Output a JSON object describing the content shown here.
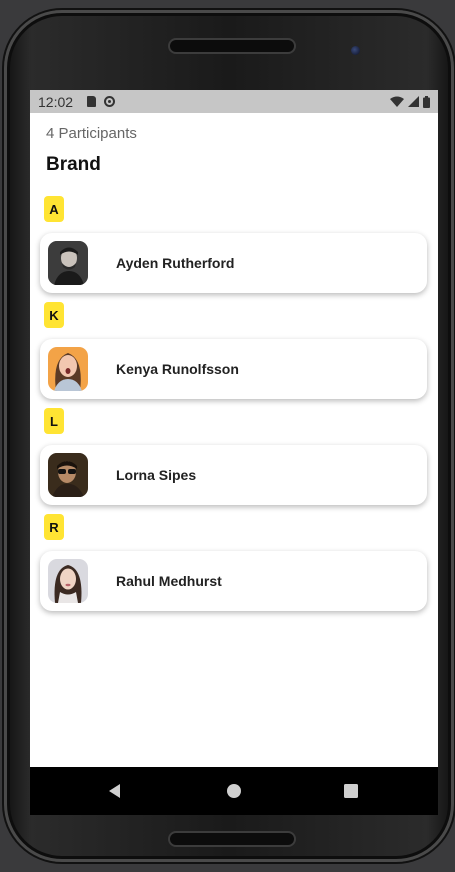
{
  "status_bar": {
    "time": "12:02",
    "icons": [
      "sim-card-icon",
      "sync-icon",
      "wifi-icon",
      "signal-icon",
      "battery-icon"
    ]
  },
  "header": {
    "participants_count_label": "4 Participants",
    "section_title": "Brand"
  },
  "groups": [
    {
      "letter": "A",
      "participant": {
        "name": "Ayden Rutherford",
        "avatar": "avatar-photo"
      }
    },
    {
      "letter": "K",
      "participant": {
        "name": "Kenya Runolfsson",
        "avatar": "avatar-photo"
      }
    },
    {
      "letter": "L",
      "participant": {
        "name": "Lorna Sipes",
        "avatar": "avatar-photo"
      }
    },
    {
      "letter": "R",
      "participant": {
        "name": "Rahul Medhurst",
        "avatar": "avatar-photo"
      }
    }
  ],
  "nav_bar": {
    "buttons": [
      "back-icon",
      "home-icon",
      "recents-icon"
    ]
  },
  "colors": {
    "badge": "#ffe433",
    "status_bar": "#c6c6c6",
    "nav_bar": "#000000"
  }
}
